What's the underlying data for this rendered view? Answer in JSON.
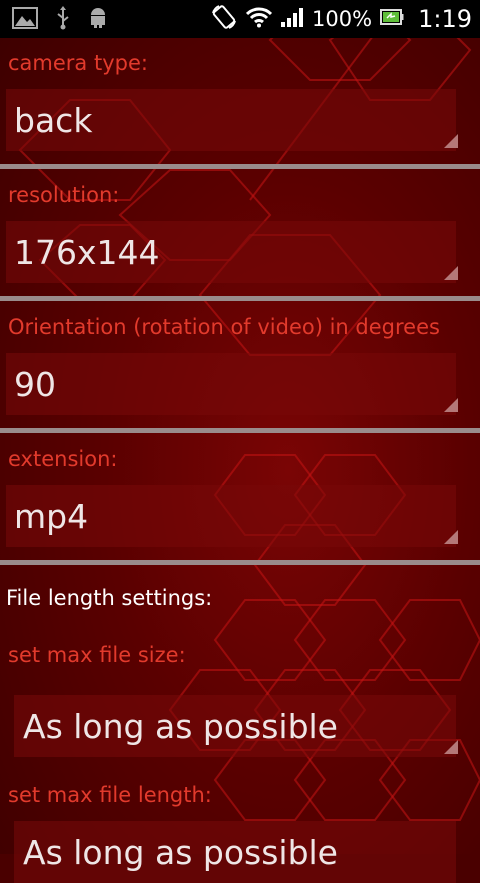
{
  "status_bar": {
    "battery_percent": "100%",
    "time": "1:19"
  },
  "settings": {
    "camera_type": {
      "label": "camera type:",
      "value": "back"
    },
    "resolution": {
      "label": "resolution:",
      "value": "176x144"
    },
    "orientation": {
      "label": "Orientation (rotation of video) in degrees",
      "value": "90"
    },
    "extension": {
      "label": "extension:",
      "value": "mp4"
    },
    "file_length_section": "File length settings:",
    "max_file_size": {
      "label": "set max file size:",
      "value": "As long as possible"
    },
    "max_file_length": {
      "label": "set max file length:",
      "value": "As long as possible"
    }
  },
  "icons": [
    "image-icon",
    "usb-icon",
    "android-icon",
    "rotate-icon",
    "wifi-icon",
    "signal-icon",
    "battery-icon"
  ],
  "colors": {
    "label_red": "#e23a2c",
    "background": "#4a0000",
    "status_bar": "#000000"
  }
}
